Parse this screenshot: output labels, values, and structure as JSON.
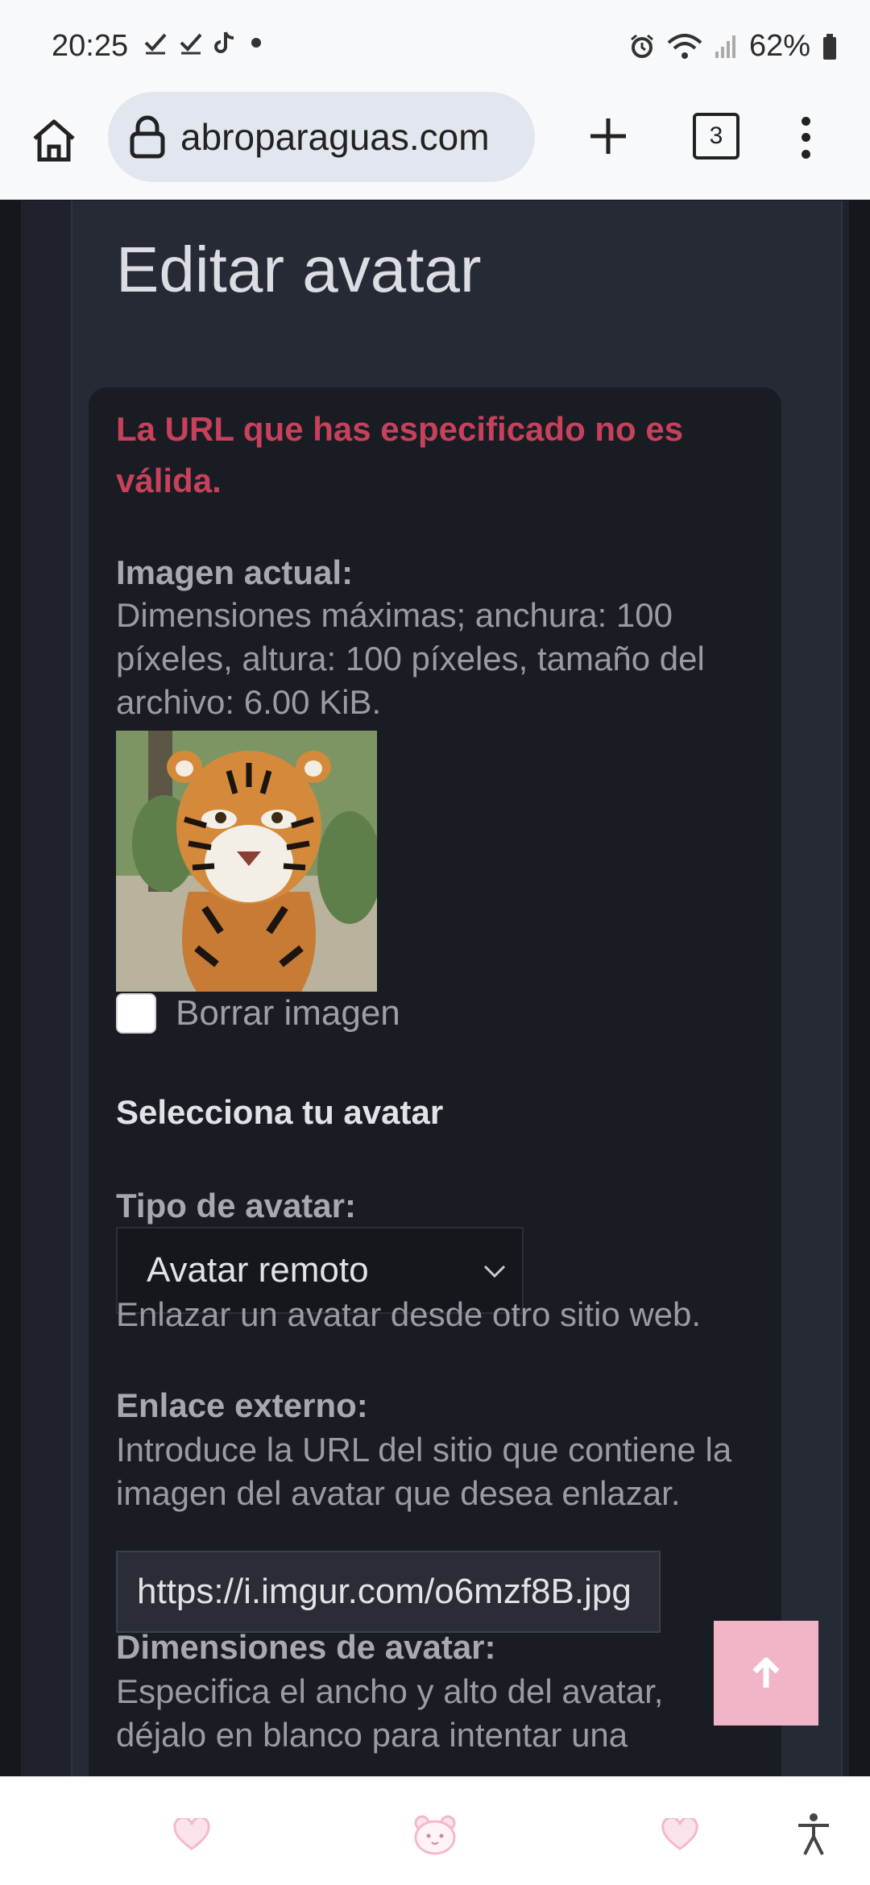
{
  "status_bar": {
    "time": "20:25",
    "battery": "62%",
    "icons_left": [
      "check-icon",
      "check-icon",
      "tiktok-icon",
      "dot-icon"
    ],
    "icons_right": [
      "alarm-icon",
      "wifi-icon",
      "signal-icon",
      "battery-icon"
    ]
  },
  "toolbar": {
    "url": "abroparaguas.com",
    "tab_count": "3"
  },
  "page": {
    "title": "Editar avatar",
    "error": "La URL que has especificado no es válida.",
    "current_image_label": "Imagen actual:",
    "current_image_desc": "Dimensiones máximas; anchura: 100 píxeles, altura: 100 píxeles, tamaño del archivo: 6.00 KiB.",
    "delete_image_label": "Borrar imagen",
    "select_avatar_heading": "Selecciona tu avatar",
    "avatar_type_label": "Tipo de avatar:",
    "avatar_type_value": "Avatar remoto",
    "avatar_type_desc": "Enlazar un avatar desde otro sitio web.",
    "external_link_label": "Enlace externo:",
    "external_link_desc": "Introduce la URL del sitio que contiene la imagen del avatar que desea enlazar.",
    "external_link_value": "https://i.imgur.com/o6mzf8B.jpg",
    "dimensions_label": "Dimensiones de avatar:",
    "dimensions_desc": "Especifica el ancho y alto del avatar, déjalo en blanco para intentar una"
  },
  "colors": {
    "accent_error": "#c7415a",
    "scroll_top_bg": "#f2b5c7",
    "nav_icon": "#f4b8cc"
  },
  "bottom_nav": [
    "heart-icon",
    "bear-face-icon",
    "heart-icon",
    "accessibility-icon"
  ]
}
